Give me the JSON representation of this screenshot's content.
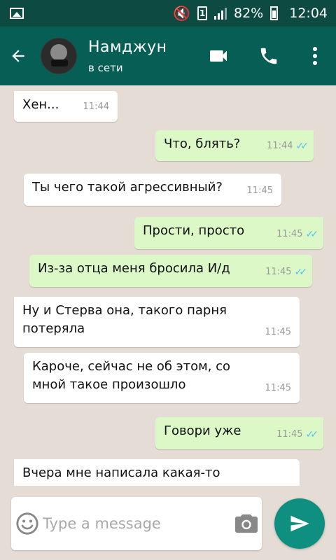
{
  "status_bar": {
    "sim_label": "1",
    "battery": "82%",
    "time": "12:04"
  },
  "header": {
    "contact_name": "Намджун",
    "contact_status": "в сети"
  },
  "messages": [
    {
      "dir": "in",
      "text": "Хен...",
      "time": "11:44"
    },
    {
      "dir": "out",
      "text": "Что, блять?",
      "time": "11:44",
      "read": true
    },
    {
      "dir": "in",
      "text": "Ты чего такой агрессивный?",
      "time": "11:45"
    },
    {
      "dir": "out",
      "text": "Прости, просто",
      "time": "11:45",
      "read": true
    },
    {
      "dir": "out",
      "text": "Из-за отца меня бросила И/д",
      "time": "11:45",
      "read": true
    },
    {
      "dir": "in",
      "text": "Ну и Стерва она, такого парня потеряла",
      "time": "11:45"
    },
    {
      "dir": "in",
      "text": "Кароче, сейчас не об этом, со мной такое произошло",
      "time": "11:45"
    },
    {
      "dir": "out",
      "text": "Говори уже",
      "time": "11:45",
      "read": true
    },
    {
      "dir": "in",
      "text": "Вчера мне написала какая-то",
      "time": ""
    }
  ],
  "input": {
    "placeholder": "Type a message",
    "value": ""
  },
  "colors": {
    "status_bar": "#0c4a42",
    "header": "#075e54",
    "chat_bg": "#e5ddd5",
    "incoming_bubble": "#ffffff",
    "outgoing_bubble": "#dcf8c6",
    "read_ticks": "#4fc3f7",
    "send_button": "#0f8f7f"
  },
  "icons": [
    "gallery-icon",
    "mute-icon",
    "sim-icon",
    "signal-icon",
    "battery-icon",
    "back-arrow-icon",
    "video-call-icon",
    "phone-icon",
    "more-vert-icon",
    "emoji-icon",
    "camera-icon",
    "send-icon"
  ]
}
